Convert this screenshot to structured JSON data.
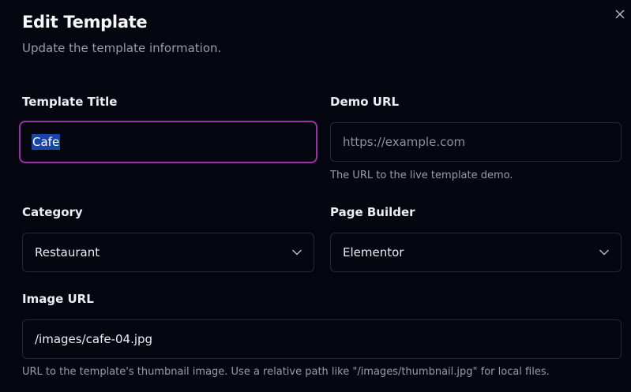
{
  "dialog": {
    "title": "Edit Template",
    "subtitle": "Update the template information."
  },
  "fields": {
    "template_title": {
      "label": "Template Title",
      "value": "Cafe"
    },
    "demo_url": {
      "label": "Demo URL",
      "value": "",
      "placeholder": "https://example.com",
      "help": "The URL to the live template demo."
    },
    "category": {
      "label": "Category",
      "selected": "Restaurant"
    },
    "page_builder": {
      "label": "Page Builder",
      "selected": "Elementor"
    },
    "image_url": {
      "label": "Image URL",
      "value": "/images/cafe-04.jpg",
      "help": "URL to the template's thumbnail image. Use a relative path like \"/images/thumbnail.jpg\" for local files."
    }
  },
  "icons": {
    "close": "close-icon",
    "chevron": "chevron-down-icon"
  },
  "colors": {
    "background": "#05060f",
    "focus_ring": "#9b2fa6",
    "selection": "#1646a8",
    "border": "#262838"
  }
}
